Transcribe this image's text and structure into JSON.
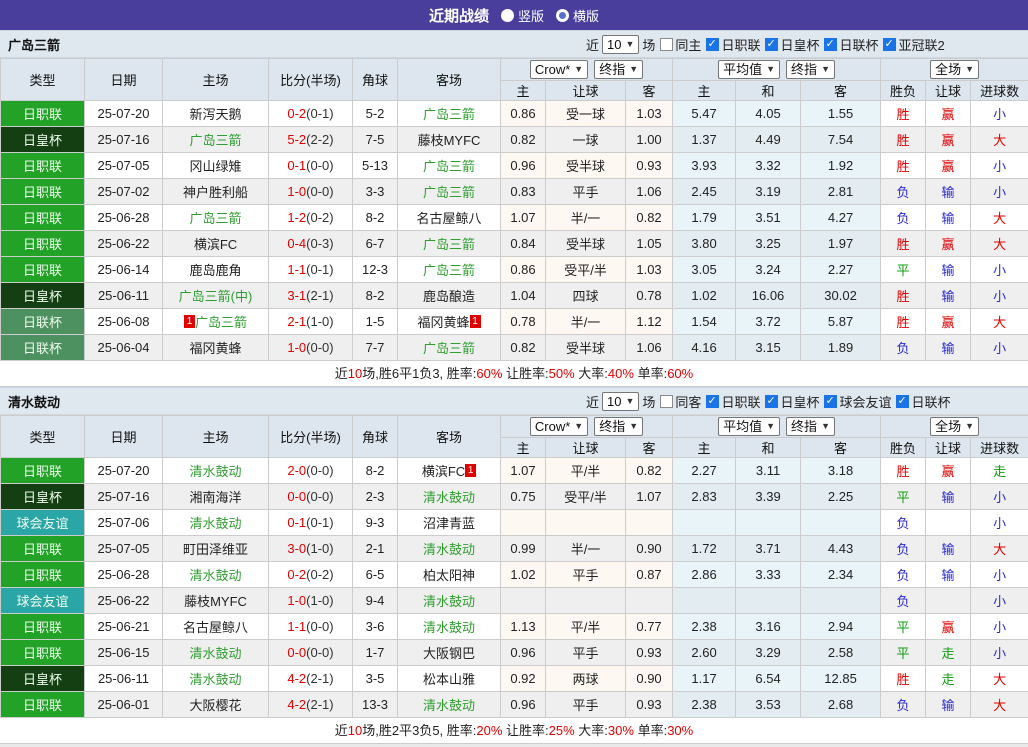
{
  "topbar": {
    "title": "近期战绩",
    "radios": [
      {
        "label": "竖版",
        "selected": true
      },
      {
        "label": "横版",
        "selected": false
      }
    ]
  },
  "table": {
    "columns": [
      "类型",
      "日期",
      "主场",
      "比分(半场)",
      "角球",
      "客场",
      "主",
      "让球",
      "客",
      "主",
      "和",
      "客",
      "胜负",
      "让球",
      "进球数"
    ],
    "selects": {
      "company": "Crow*",
      "company_mode": "终指",
      "average": "平均值",
      "average_mode": "终指",
      "scope": "全场"
    }
  },
  "league_colors": {
    "日职联": "#22a226",
    "日皇杯": "#133f13",
    "日联杯": "#4e9160",
    "球会友谊": "#2ba6a6"
  },
  "result_colors": {
    "red": "#e00000",
    "green": "#0f9d0f",
    "blue": "#2929d4"
  },
  "sections": [
    {
      "team": "广岛三箭",
      "filters": {
        "prefix": "近",
        "count": "10",
        "suffix": "场",
        "same": {
          "label": "同主",
          "checked": false
        },
        "leagues": [
          {
            "label": "日职联",
            "checked": true
          },
          {
            "label": "日皇杯",
            "checked": true
          },
          {
            "label": "日联杯",
            "checked": true
          },
          {
            "label": "亚冠联2",
            "checked": true
          }
        ]
      },
      "rows": [
        {
          "league": "日职联",
          "date": "25-07-20",
          "home": "新泻天鹅",
          "home_hl": false,
          "home_badge": "",
          "score": "0-2",
          "half": "(0-1)",
          "corner": "5-2",
          "away": "广岛三箭",
          "away_hl": true,
          "away_badge": "",
          "odds_home": "0.86",
          "handicap": "受一球",
          "odds_away": "1.03",
          "avg_home": "5.47",
          "avg_draw": "4.05",
          "avg_away": "1.55",
          "outcome": "胜",
          "outcome_color": "red",
          "handicap_result": "赢",
          "handicap_result_color": "red",
          "goals": "小",
          "goals_color": "blue"
        },
        {
          "league": "日皇杯",
          "date": "25-07-16",
          "home": "广岛三箭",
          "home_hl": true,
          "home_badge": "",
          "score": "5-2",
          "half": "(2-2)",
          "corner": "7-5",
          "away": "藤枝MYFC",
          "away_hl": false,
          "away_badge": "",
          "odds_home": "0.82",
          "handicap": "一球",
          "odds_away": "1.00",
          "avg_home": "1.37",
          "avg_draw": "4.49",
          "avg_away": "7.54",
          "outcome": "胜",
          "outcome_color": "red",
          "handicap_result": "赢",
          "handicap_result_color": "red",
          "goals": "大",
          "goals_color": "red"
        },
        {
          "league": "日职联",
          "date": "25-07-05",
          "home": "冈山绿雉",
          "home_hl": false,
          "home_badge": "",
          "score": "0-1",
          "half": "(0-0)",
          "corner": "5-13",
          "away": "广岛三箭",
          "away_hl": true,
          "away_badge": "",
          "odds_home": "0.96",
          "handicap": "受半球",
          "odds_away": "0.93",
          "avg_home": "3.93",
          "avg_draw": "3.32",
          "avg_away": "1.92",
          "outcome": "胜",
          "outcome_color": "red",
          "handicap_result": "赢",
          "handicap_result_color": "red",
          "goals": "小",
          "goals_color": "blue"
        },
        {
          "league": "日职联",
          "date": "25-07-02",
          "home": "神户胜利船",
          "home_hl": false,
          "home_badge": "",
          "score": "1-0",
          "half": "(0-0)",
          "corner": "3-3",
          "away": "广岛三箭",
          "away_hl": true,
          "away_badge": "",
          "odds_home": "0.83",
          "handicap": "平手",
          "odds_away": "1.06",
          "avg_home": "2.45",
          "avg_draw": "3.19",
          "avg_away": "2.81",
          "outcome": "负",
          "outcome_color": "blue",
          "handicap_result": "输",
          "handicap_result_color": "blue",
          "goals": "小",
          "goals_color": "blue"
        },
        {
          "league": "日职联",
          "date": "25-06-28",
          "home": "广岛三箭",
          "home_hl": true,
          "home_badge": "",
          "score": "1-2",
          "half": "(0-2)",
          "corner": "8-2",
          "away": "名古屋鲸八",
          "away_hl": false,
          "away_badge": "",
          "odds_home": "1.07",
          "handicap": "半/一",
          "odds_away": "0.82",
          "avg_home": "1.79",
          "avg_draw": "3.51",
          "avg_away": "4.27",
          "outcome": "负",
          "outcome_color": "blue",
          "handicap_result": "输",
          "handicap_result_color": "blue",
          "goals": "大",
          "goals_color": "red"
        },
        {
          "league": "日职联",
          "date": "25-06-22",
          "home": "横滨FC",
          "home_hl": false,
          "home_badge": "",
          "score": "0-4",
          "half": "(0-3)",
          "corner": "6-7",
          "away": "广岛三箭",
          "away_hl": true,
          "away_badge": "",
          "odds_home": "0.84",
          "handicap": "受半球",
          "odds_away": "1.05",
          "avg_home": "3.80",
          "avg_draw": "3.25",
          "avg_away": "1.97",
          "outcome": "胜",
          "outcome_color": "red",
          "handicap_result": "赢",
          "handicap_result_color": "red",
          "goals": "大",
          "goals_color": "red"
        },
        {
          "league": "日职联",
          "date": "25-06-14",
          "home": "鹿岛鹿角",
          "home_hl": false,
          "home_badge": "",
          "score": "1-1",
          "half": "(0-1)",
          "corner": "12-3",
          "away": "广岛三箭",
          "away_hl": true,
          "away_badge": "",
          "odds_home": "0.86",
          "handicap": "受平/半",
          "odds_away": "1.03",
          "avg_home": "3.05",
          "avg_draw": "3.24",
          "avg_away": "2.27",
          "outcome": "平",
          "outcome_color": "green",
          "handicap_result": "输",
          "handicap_result_color": "blue",
          "goals": "小",
          "goals_color": "blue"
        },
        {
          "league": "日皇杯",
          "date": "25-06-11",
          "home": "广岛三箭(中)",
          "home_hl": true,
          "home_badge": "",
          "score": "3-1",
          "half": "(2-1)",
          "corner": "8-2",
          "away": "鹿岛酿造",
          "away_hl": false,
          "away_badge": "",
          "odds_home": "1.04",
          "handicap": "四球",
          "odds_away": "0.78",
          "avg_home": "1.02",
          "avg_draw": "16.06",
          "avg_away": "30.02",
          "outcome": "胜",
          "outcome_color": "red",
          "handicap_result": "输",
          "handicap_result_color": "blue",
          "goals": "小",
          "goals_color": "blue"
        },
        {
          "league": "日联杯",
          "date": "25-06-08",
          "home": "广岛三箭",
          "home_hl": true,
          "home_badge": "1",
          "score": "2-1",
          "half": "(1-0)",
          "corner": "1-5",
          "away": "福冈黄蜂",
          "away_hl": false,
          "away_badge": "1",
          "odds_home": "0.78",
          "handicap": "半/一",
          "odds_away": "1.12",
          "avg_home": "1.54",
          "avg_draw": "3.72",
          "avg_away": "5.87",
          "outcome": "胜",
          "outcome_color": "red",
          "handicap_result": "赢",
          "handicap_result_color": "red",
          "goals": "大",
          "goals_color": "red"
        },
        {
          "league": "日联杯",
          "date": "25-06-04",
          "home": "福冈黄蜂",
          "home_hl": false,
          "home_badge": "",
          "score": "1-0",
          "half": "(0-0)",
          "corner": "7-7",
          "away": "广岛三箭",
          "away_hl": true,
          "away_badge": "",
          "odds_home": "0.82",
          "handicap": "受半球",
          "odds_away": "1.06",
          "avg_home": "4.16",
          "avg_draw": "3.15",
          "avg_away": "1.89",
          "outcome": "负",
          "outcome_color": "blue",
          "handicap_result": "输",
          "handicap_result_color": "blue",
          "goals": "小",
          "goals_color": "blue"
        }
      ],
      "summary": [
        {
          "text": "近"
        },
        {
          "text": "10",
          "red": true
        },
        {
          "text": "场,胜6平1负3, 胜率:"
        },
        {
          "text": "60%",
          "red": true
        },
        {
          "text": " 让胜率:"
        },
        {
          "text": "50%",
          "red": true
        },
        {
          "text": " 大率:"
        },
        {
          "text": "40%",
          "red": true
        },
        {
          "text": " 单率:"
        },
        {
          "text": "60%",
          "red": true
        }
      ]
    },
    {
      "team": "清水鼓动",
      "filters": {
        "prefix": "近",
        "count": "10",
        "suffix": "场",
        "same": {
          "label": "同客",
          "checked": false
        },
        "leagues": [
          {
            "label": "日职联",
            "checked": true
          },
          {
            "label": "日皇杯",
            "checked": true
          },
          {
            "label": "球会友谊",
            "checked": true
          },
          {
            "label": "日联杯",
            "checked": true
          }
        ]
      },
      "rows": [
        {
          "league": "日职联",
          "date": "25-07-20",
          "home": "清水鼓动",
          "home_hl": true,
          "home_badge": "",
          "score": "2-0",
          "half": "(0-0)",
          "corner": "8-2",
          "away": "横滨FC",
          "away_hl": false,
          "away_badge": "1",
          "odds_home": "1.07",
          "handicap": "平/半",
          "odds_away": "0.82",
          "avg_home": "2.27",
          "avg_draw": "3.11",
          "avg_away": "3.18",
          "outcome": "胜",
          "outcome_color": "red",
          "handicap_result": "赢",
          "handicap_result_color": "red",
          "goals": "走",
          "goals_color": "green"
        },
        {
          "league": "日皇杯",
          "date": "25-07-16",
          "home": "湘南海洋",
          "home_hl": false,
          "home_badge": "",
          "score": "0-0",
          "half": "(0-0)",
          "corner": "2-3",
          "away": "清水鼓动",
          "away_hl": true,
          "away_badge": "",
          "odds_home": "0.75",
          "handicap": "受平/半",
          "odds_away": "1.07",
          "avg_home": "2.83",
          "avg_draw": "3.39",
          "avg_away": "2.25",
          "outcome": "平",
          "outcome_color": "green",
          "handicap_result": "输",
          "handicap_result_color": "blue",
          "goals": "小",
          "goals_color": "blue"
        },
        {
          "league": "球会友谊",
          "date": "25-07-06",
          "home": "清水鼓动",
          "home_hl": true,
          "home_badge": "",
          "score": "0-1",
          "half": "(0-1)",
          "corner": "9-3",
          "away": "沼津青蓝",
          "away_hl": false,
          "away_badge": "",
          "odds_home": "",
          "handicap": "",
          "odds_away": "",
          "avg_home": "",
          "avg_draw": "",
          "avg_away": "",
          "outcome": "负",
          "outcome_color": "blue",
          "handicap_result": "",
          "handicap_result_color": "",
          "goals": "小",
          "goals_color": "blue"
        },
        {
          "league": "日职联",
          "date": "25-07-05",
          "home": "町田泽维亚",
          "home_hl": false,
          "home_badge": "",
          "score": "3-0",
          "half": "(1-0)",
          "corner": "2-1",
          "away": "清水鼓动",
          "away_hl": true,
          "away_badge": "",
          "odds_home": "0.99",
          "handicap": "半/一",
          "odds_away": "0.90",
          "avg_home": "1.72",
          "avg_draw": "3.71",
          "avg_away": "4.43",
          "outcome": "负",
          "outcome_color": "blue",
          "handicap_result": "输",
          "handicap_result_color": "blue",
          "goals": "大",
          "goals_color": "red"
        },
        {
          "league": "日职联",
          "date": "25-06-28",
          "home": "清水鼓动",
          "home_hl": true,
          "home_badge": "",
          "score": "0-2",
          "half": "(0-2)",
          "corner": "6-5",
          "away": "柏太阳神",
          "away_hl": false,
          "away_badge": "",
          "odds_home": "1.02",
          "handicap": "平手",
          "odds_away": "0.87",
          "avg_home": "2.86",
          "avg_draw": "3.33",
          "avg_away": "2.34",
          "outcome": "负",
          "outcome_color": "blue",
          "handicap_result": "输",
          "handicap_result_color": "blue",
          "goals": "小",
          "goals_color": "blue"
        },
        {
          "league": "球会友谊",
          "date": "25-06-22",
          "home": "藤枝MYFC",
          "home_hl": false,
          "home_badge": "",
          "score": "1-0",
          "half": "(1-0)",
          "corner": "9-4",
          "away": "清水鼓动",
          "away_hl": true,
          "away_badge": "",
          "odds_home": "",
          "handicap": "",
          "odds_away": "",
          "avg_home": "",
          "avg_draw": "",
          "avg_away": "",
          "outcome": "负",
          "outcome_color": "blue",
          "handicap_result": "",
          "handicap_result_color": "",
          "goals": "小",
          "goals_color": "blue"
        },
        {
          "league": "日职联",
          "date": "25-06-21",
          "home": "名古屋鲸八",
          "home_hl": false,
          "home_badge": "",
          "score": "1-1",
          "half": "(0-0)",
          "corner": "3-6",
          "away": "清水鼓动",
          "away_hl": true,
          "away_badge": "",
          "odds_home": "1.13",
          "handicap": "平/半",
          "odds_away": "0.77",
          "avg_home": "2.38",
          "avg_draw": "3.16",
          "avg_away": "2.94",
          "outcome": "平",
          "outcome_color": "green",
          "handicap_result": "赢",
          "handicap_result_color": "red",
          "goals": "小",
          "goals_color": "blue"
        },
        {
          "league": "日职联",
          "date": "25-06-15",
          "home": "清水鼓动",
          "home_hl": true,
          "home_badge": "",
          "score": "0-0",
          "half": "(0-0)",
          "corner": "1-7",
          "away": "大阪钢巴",
          "away_hl": false,
          "away_badge": "",
          "odds_home": "0.96",
          "handicap": "平手",
          "odds_away": "0.93",
          "avg_home": "2.60",
          "avg_draw": "3.29",
          "avg_away": "2.58",
          "outcome": "平",
          "outcome_color": "green",
          "handicap_result": "走",
          "handicap_result_color": "green",
          "goals": "小",
          "goals_color": "blue"
        },
        {
          "league": "日皇杯",
          "date": "25-06-11",
          "home": "清水鼓动",
          "home_hl": true,
          "home_badge": "",
          "score": "4-2",
          "half": "(2-1)",
          "corner": "3-5",
          "away": "松本山雅",
          "away_hl": false,
          "away_badge": "",
          "odds_home": "0.92",
          "handicap": "两球",
          "odds_away": "0.90",
          "avg_home": "1.17",
          "avg_draw": "6.54",
          "avg_away": "12.85",
          "outcome": "胜",
          "outcome_color": "red",
          "handicap_result": "走",
          "handicap_result_color": "green",
          "goals": "大",
          "goals_color": "red"
        },
        {
          "league": "日职联",
          "date": "25-06-01",
          "home": "大阪樱花",
          "home_hl": false,
          "home_badge": "",
          "score": "4-2",
          "half": "(2-1)",
          "corner": "13-3",
          "away": "清水鼓动",
          "away_hl": true,
          "away_badge": "",
          "odds_home": "0.96",
          "handicap": "平手",
          "odds_away": "0.93",
          "avg_home": "2.38",
          "avg_draw": "3.53",
          "avg_away": "2.68",
          "outcome": "负",
          "outcome_color": "blue",
          "handicap_result": "输",
          "handicap_result_color": "blue",
          "goals": "大",
          "goals_color": "red"
        }
      ],
      "summary": [
        {
          "text": "近"
        },
        {
          "text": "10",
          "red": true
        },
        {
          "text": "场,胜2平3负5, 胜率:"
        },
        {
          "text": "20%",
          "red": true
        },
        {
          "text": " 让胜率:"
        },
        {
          "text": "25%",
          "red": true
        },
        {
          "text": " 大率:"
        },
        {
          "text": "30%",
          "red": true
        },
        {
          "text": " 单率:"
        },
        {
          "text": "30%",
          "red": true
        }
      ]
    }
  ]
}
